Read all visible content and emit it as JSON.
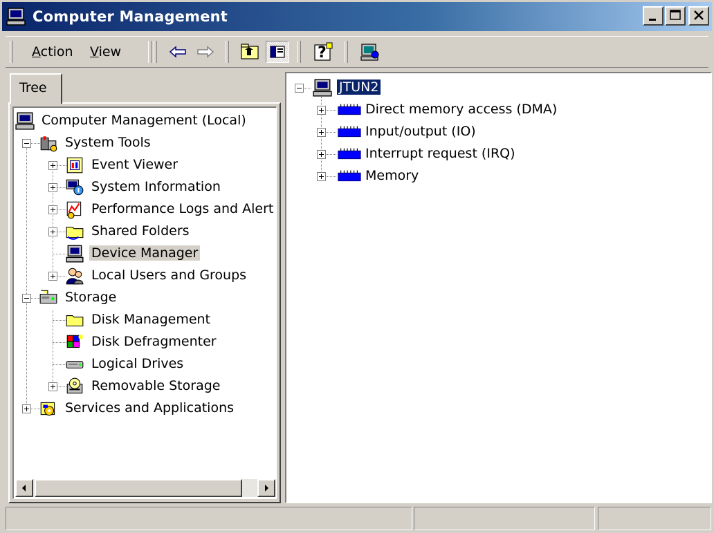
{
  "window": {
    "title": "Computer Management",
    "buttons": [
      "minimize-icon",
      "maximize-icon",
      "close-icon"
    ]
  },
  "toolbar": {
    "menus": [
      {
        "label": "Action",
        "accel": "A"
      },
      {
        "label": "View",
        "accel": "V"
      }
    ],
    "buttons": [
      "back-arrow-icon",
      "forward-arrow-icon",
      "up-one-level-icon",
      "show-hide-tree-icon",
      "help-icon",
      "computer-properties-icon"
    ]
  },
  "left_pane": {
    "tab_label": "Tree",
    "tree": [
      {
        "label": "Computer Management (Local)",
        "icon": "computer-icon"
      },
      {
        "label": "System Tools",
        "icon": "tools-icon"
      },
      {
        "label": "Event Viewer",
        "icon": "event-viewer-icon"
      },
      {
        "label": "System Information",
        "icon": "system-info-icon"
      },
      {
        "label": "Performance Logs and Alert",
        "icon": "performance-icon"
      },
      {
        "label": "Shared Folders",
        "icon": "shared-folder-icon"
      },
      {
        "label": "Device Manager",
        "icon": "device-manager-icon",
        "selected": true
      },
      {
        "label": "Local Users and Groups",
        "icon": "users-icon"
      },
      {
        "label": "Storage",
        "icon": "storage-icon"
      },
      {
        "label": "Disk Management",
        "icon": "folder-icon"
      },
      {
        "label": "Disk Defragmenter",
        "icon": "defrag-icon"
      },
      {
        "label": "Logical Drives",
        "icon": "drive-icon"
      },
      {
        "label": "Removable Storage",
        "icon": "removable-storage-icon"
      },
      {
        "label": "Services and Applications",
        "icon": "services-icon"
      }
    ]
  },
  "right_pane": {
    "root": {
      "label": "JTUN2",
      "icon": "computer-icon"
    },
    "children": [
      {
        "label": "Direct memory access (DMA)",
        "icon": "chip-icon"
      },
      {
        "label": "Input/output (IO)",
        "icon": "chip-icon"
      },
      {
        "label": "Interrupt request (IRQ)",
        "icon": "chip-icon"
      },
      {
        "label": "Memory",
        "icon": "chip-icon"
      }
    ]
  },
  "colors": {
    "face": "#d4d0c8",
    "title_start": "#0a246a",
    "title_end": "#a6caf0",
    "selection": "#0a246a"
  }
}
